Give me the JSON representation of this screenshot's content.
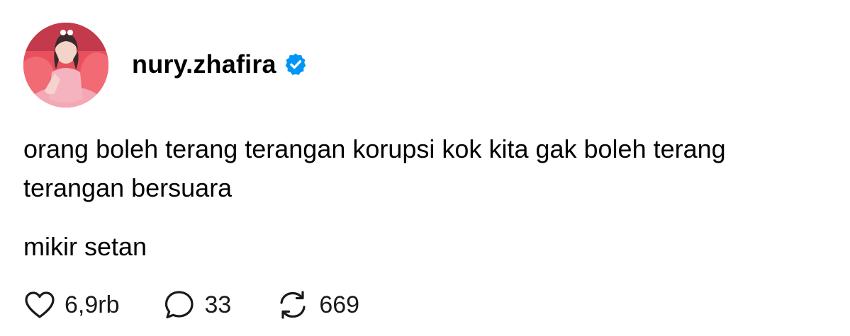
{
  "post": {
    "username": "nury.zhafira",
    "verified_icon": "verified-badge-icon",
    "verified_color": "#0095f6",
    "text_paragraph_1": "orang boleh terang terangan korupsi kok kita gak boleh terang terangan bersuara",
    "text_paragraph_2": "mikir setan",
    "actions": {
      "like": {
        "icon": "heart-icon",
        "count": "6,9rb"
      },
      "reply": {
        "icon": "comment-icon",
        "count": "33"
      },
      "repost": {
        "icon": "repost-icon",
        "count": "669"
      }
    }
  }
}
